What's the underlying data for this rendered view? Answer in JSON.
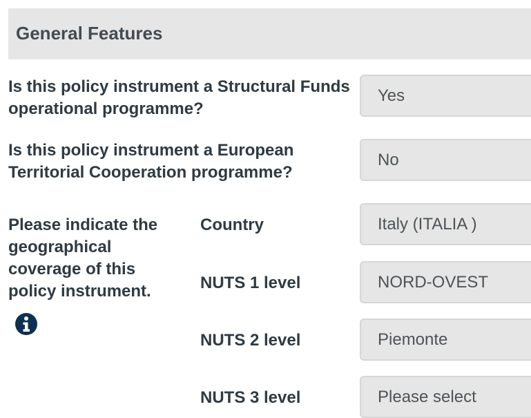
{
  "section": {
    "title": "General Features"
  },
  "questions": [
    {
      "label": "Is this policy instrument a Structural Funds operational programme?",
      "value": "Yes"
    },
    {
      "label": "Is this policy instrument a European Territorial Cooperation programme?",
      "value": "No"
    }
  ],
  "geographical": {
    "label": "Please indicate the geographical coverage of this policy instrument.",
    "info_icon": "info-circle-icon",
    "levels": [
      {
        "label": "Country",
        "value": "Italy (ITALIA )"
      },
      {
        "label": "NUTS 1 level",
        "value": "NORD-OVEST"
      },
      {
        "label": "NUTS 2 level",
        "value": "Piemonte"
      },
      {
        "label": "NUTS 3 level",
        "value": "Please select"
      }
    ]
  },
  "colors": {
    "header_bg": "#e6e6e6",
    "text": "#2f3a41",
    "field_bg": "#e6e6e6",
    "icon": "#0d2f52"
  }
}
